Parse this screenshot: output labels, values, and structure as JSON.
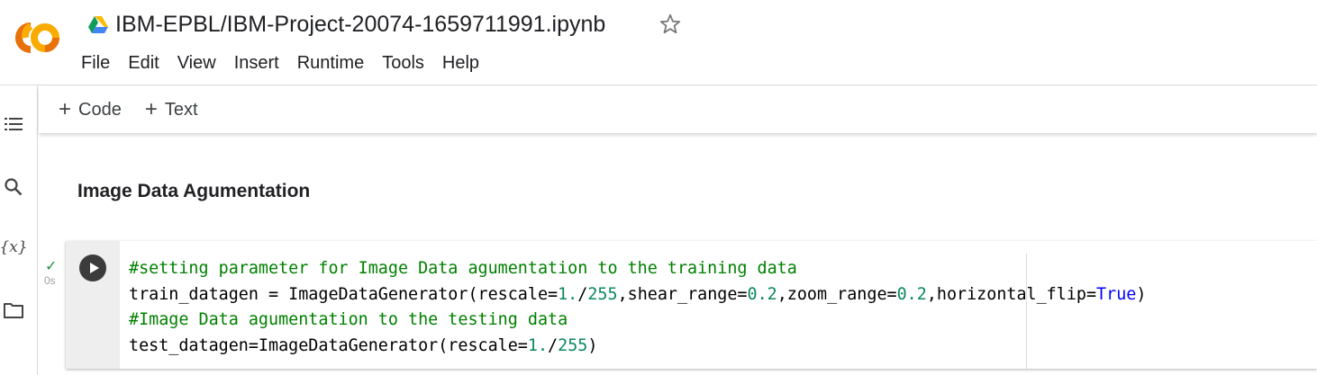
{
  "app": {
    "logo_text": "CO",
    "brand_colors": {
      "orange": "#f9ab00",
      "dark_orange": "#e8710a"
    },
    "notebook_title": "IBM-EPBL/IBM-Project-20074-1659711991.ipynb"
  },
  "menu": [
    "File",
    "Edit",
    "View",
    "Insert",
    "Runtime",
    "Tools",
    "Help"
  ],
  "toolbar": {
    "add_code_label": "Code",
    "add_text_label": "Text"
  },
  "siderail": {
    "items": [
      "table-of-contents-icon",
      "search-icon",
      "variables-icon",
      "files-icon"
    ],
    "variables_glyph": "{x}"
  },
  "text_cell": {
    "heading": "Image Data Agumentation"
  },
  "code_cell": {
    "status_check": "✓",
    "exec_time": "0s",
    "lines": [
      [
        {
          "t": "#setting parameter for Image Data agumentation to the training data",
          "k": "comment"
        }
      ],
      [
        {
          "t": "train_datagen = ImageDataGenerator(rescale=",
          "k": "plain"
        },
        {
          "t": "1.",
          "k": "num"
        },
        {
          "t": "/",
          "k": "plain"
        },
        {
          "t": "255",
          "k": "num"
        },
        {
          "t": ",shear_range=",
          "k": "plain"
        },
        {
          "t": "0.2",
          "k": "num"
        },
        {
          "t": ",zoom_range=",
          "k": "plain"
        },
        {
          "t": "0.2",
          "k": "num"
        },
        {
          "t": ",horizontal_flip=",
          "k": "plain"
        },
        {
          "t": "True",
          "k": "kw"
        },
        {
          "t": ")",
          "k": "plain"
        }
      ],
      [
        {
          "t": "#Image Data agumentation to the testing data",
          "k": "comment"
        }
      ],
      [
        {
          "t": "test_datagen=ImageDataGenerator(rescale=",
          "k": "plain"
        },
        {
          "t": "1.",
          "k": "num"
        },
        {
          "t": "/",
          "k": "plain"
        },
        {
          "t": "255",
          "k": "num"
        },
        {
          "t": ")",
          "k": "plain"
        }
      ]
    ]
  }
}
